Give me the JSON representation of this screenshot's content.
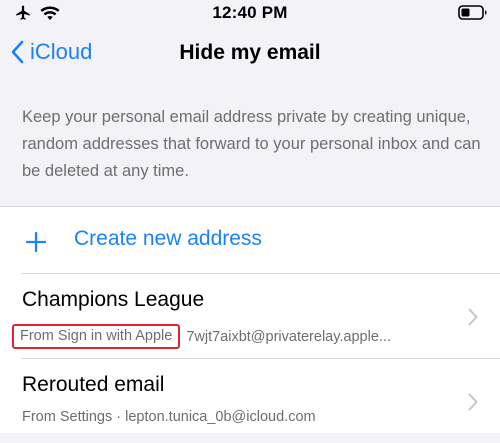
{
  "status_bar": {
    "time": "12:40 PM",
    "icons": [
      "airplane-icon",
      "wifi-icon",
      "battery-icon"
    ]
  },
  "nav": {
    "back_label": "iCloud",
    "title": "Hide my email"
  },
  "description": "Keep your personal email address private by creating unique, random addresses that forward to your personal inbox and can be deleted at any time.",
  "create": {
    "label": "Create new address"
  },
  "addresses": [
    {
      "label": "Champions League",
      "source": "From Sign in with Apple",
      "email": "7wjt7aixbt@privaterelay.apple..."
    },
    {
      "label": "Rerouted email",
      "source": "From Settings · lepton.tunica_0b@icloud.com",
      "email": ""
    }
  ],
  "colors": {
    "accent": "#1a82f7",
    "highlight": "#e0262b",
    "background": "#f2f2f7",
    "secondary_text": "#6d6d72"
  }
}
